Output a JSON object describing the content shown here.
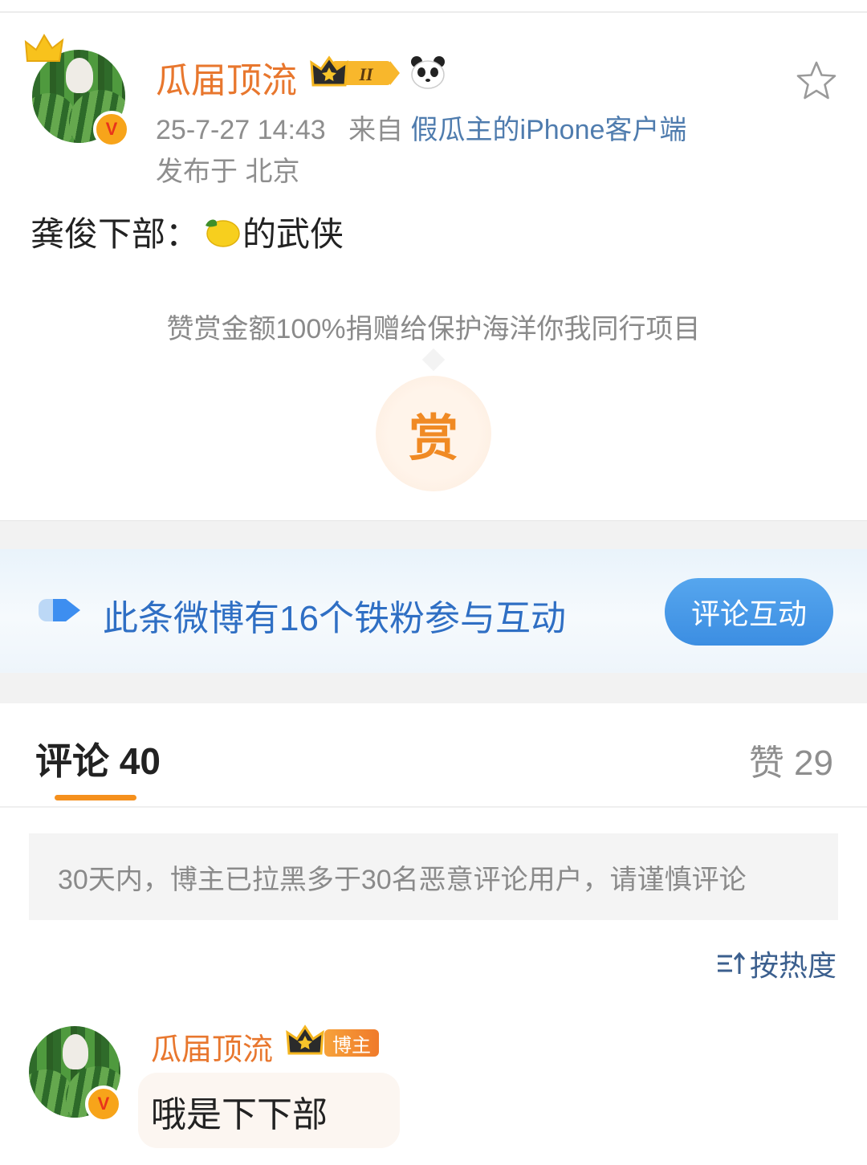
{
  "post": {
    "username": "瓜届顶流",
    "level_badge": "II",
    "timestamp": "25-7-27 14:43",
    "from_label": "来自",
    "source": "假瓜主的iPhone客户端",
    "location": "发布于 北京",
    "content_prefix": "龚俊下部：",
    "content_emoji": "lemon-emoji",
    "content_suffix": "的武侠",
    "verified_mark": "V",
    "star_icon": "star-outline-icon"
  },
  "reward": {
    "note": "赞赏金额100%捐赠给保护海洋你我同行项目",
    "button_label": "赏"
  },
  "fans_banner": {
    "text": "此条微博有16个铁粉参与互动",
    "button_label": "评论互动"
  },
  "tabs": {
    "comments_label": "评论 40",
    "likes_label": "赞 29"
  },
  "notice": "30天内，博主已拉黑多于30名恶意评论用户，请谨慎评论",
  "sort_label": "按热度",
  "comments": [
    {
      "username": "瓜届顶流",
      "tag": "博主",
      "text": "哦是下下部",
      "verified_mark": "V"
    }
  ],
  "colors": {
    "username": "#e8772e",
    "link": "#4f7cae",
    "accent": "#f5901d",
    "fans_blue": "#2f6fc4"
  }
}
